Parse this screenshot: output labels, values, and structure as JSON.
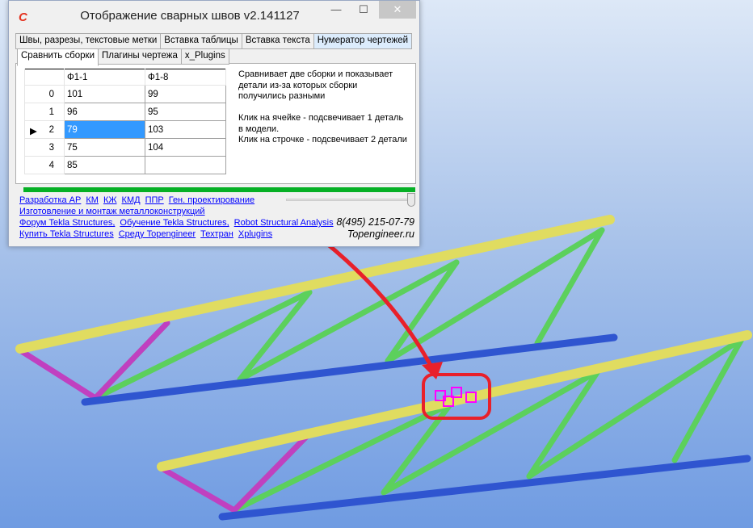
{
  "window": {
    "title": "Отображение сварных швов v2.141127",
    "logo": "C",
    "minimize": "—",
    "maximize": "☐",
    "close": "✕"
  },
  "tabs_row1": [
    "Швы, разрезы, текстовые метки",
    "Вставка таблицы",
    "Вставка текста",
    "Нумератор чертежей"
  ],
  "tabs_row2": [
    "Сравнить сборки",
    "Плагины чертежа",
    "x_Plugins"
  ],
  "grid": {
    "columns": [
      "Ф1-1",
      "Ф1-8"
    ],
    "rows": [
      {
        "index": "0",
        "a": "101",
        "b": "99"
      },
      {
        "index": "1",
        "a": "96",
        "b": "95"
      },
      {
        "index": "2",
        "a": "79",
        "b": "103"
      },
      {
        "index": "3",
        "a": "75",
        "b": "104"
      },
      {
        "index": "4",
        "a": "85",
        "b": ""
      }
    ],
    "selected_row": 2
  },
  "description": "Сравнивает две сборки и показывает\nдетали из-за которых сборки\nполучились разными\n\nКлик на ячейке - подсвечивает 1 деталь\nв модели.\nКлик на строчке - подсвечивает 2 детали",
  "progress": 100,
  "slider_value": 100,
  "links": {
    "row1": [
      "Разработка АР",
      "КМ",
      "КЖ",
      "КМД",
      "ППР",
      "Ген. проектирование"
    ],
    "row2": [
      "Изготовление и монтаж металлоконструкций"
    ],
    "row3": [
      "Форум Tekla Structures,",
      "Обучение Tekla Structures,",
      "Robot Structural Analysis"
    ],
    "row4": [
      "Купить Tekla Structures",
      "Среду Topengineer",
      "Техтран",
      "Xplugins"
    ]
  },
  "phone": "8(495) 215-07-79",
  "site": "Topengineer.ru",
  "colors": {
    "top_chord": "#e0dc60",
    "bottom_chord": "#2f55d0",
    "diagonal": "#5cd05c",
    "end_diagonal": "#c040c0",
    "highlight": "#ff00ff",
    "arrow": "#e8202a"
  }
}
